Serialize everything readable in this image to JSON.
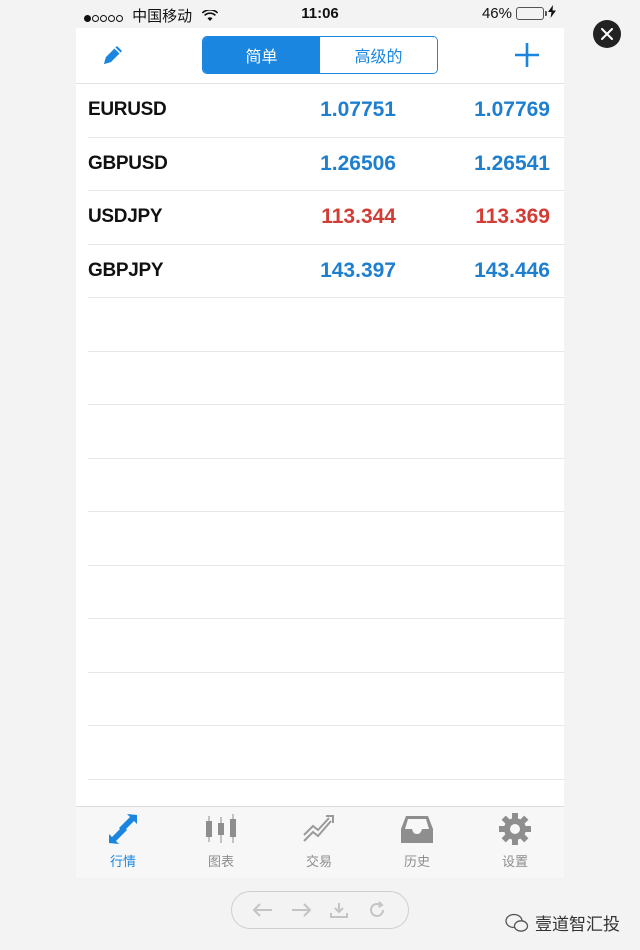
{
  "status_bar": {
    "carrier": "中国移动",
    "time": "11:06",
    "battery": "46%",
    "signal_bars_filled": 1,
    "signal_bars_total": 5
  },
  "header": {
    "segments": [
      {
        "label": "简单",
        "active": true
      },
      {
        "label": "高级的",
        "active": false
      }
    ]
  },
  "quotes": [
    {
      "symbol": "EURUSD",
      "bid": "1.07751",
      "ask": "1.07769",
      "color": "#1f7fcf"
    },
    {
      "symbol": "GBPUSD",
      "bid": "1.26506",
      "ask": "1.26541",
      "color": "#1f7fcf"
    },
    {
      "symbol": "USDJPY",
      "bid": "113.344",
      "ask": "113.369",
      "color": "#d23c34"
    },
    {
      "symbol": "GBPJPY",
      "bid": "143.397",
      "ask": "143.446",
      "color": "#1f7fcf"
    }
  ],
  "tabs": [
    {
      "label": "行情",
      "icon": "quotes-arrows-icon",
      "active": true
    },
    {
      "label": "图表",
      "icon": "candlestick-chart-icon",
      "active": false
    },
    {
      "label": "交易",
      "icon": "trade-trend-icon",
      "active": false
    },
    {
      "label": "历史",
      "icon": "history-inbox-icon",
      "active": false
    },
    {
      "label": "设置",
      "icon": "gear-icon",
      "active": false
    }
  ],
  "watermark": "壹道智汇投",
  "colors": {
    "accent": "#1a86e0",
    "up": "#1f7fcf",
    "down": "#d23c34"
  }
}
